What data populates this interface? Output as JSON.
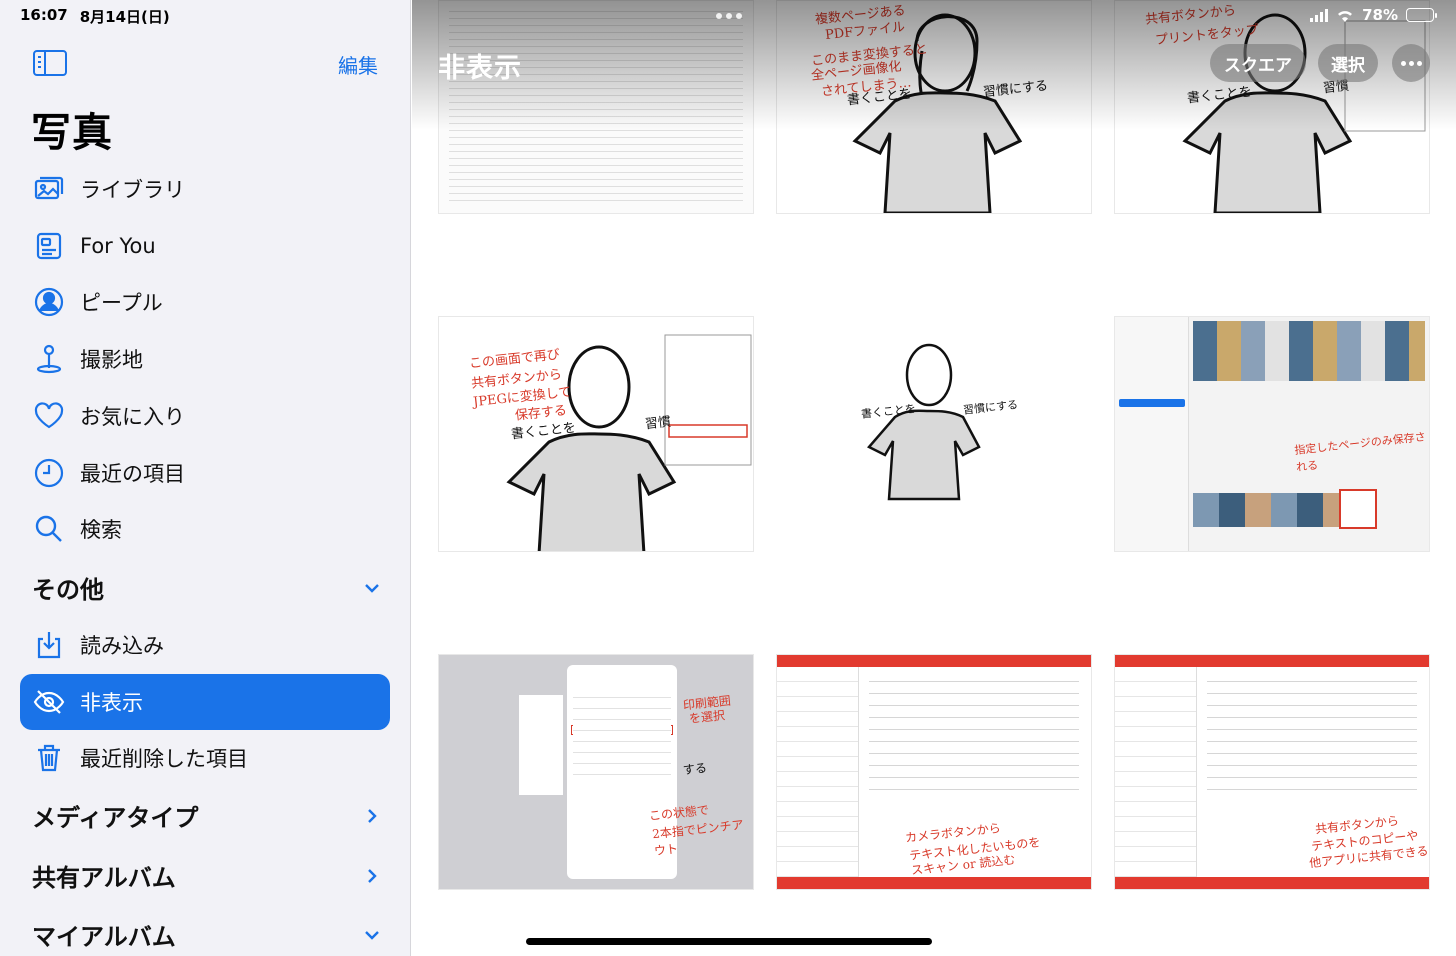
{
  "status": {
    "time": "16:07",
    "date": "8月14日(日)",
    "battery": "78%",
    "battery_level": 0.78
  },
  "sidebar": {
    "edit_label": "編集",
    "title": "写真",
    "items": [
      {
        "label": "ライブラリ",
        "icon": "photo-library-icon"
      },
      {
        "label": "For You",
        "icon": "for-you-icon"
      },
      {
        "label": "ピープル",
        "icon": "person-icon"
      },
      {
        "label": "撮影地",
        "icon": "map-pin-icon"
      },
      {
        "label": "お気に入り",
        "icon": "heart-icon"
      },
      {
        "label": "最近の項目",
        "icon": "clock-icon"
      },
      {
        "label": "検索",
        "icon": "search-icon"
      }
    ],
    "other_section": {
      "label": "その他",
      "items": [
        {
          "label": "読み込み",
          "icon": "import-icon"
        },
        {
          "label": "非表示",
          "icon": "eye-slash-icon",
          "selected": true
        },
        {
          "label": "最近削除した項目",
          "icon": "trash-icon"
        }
      ]
    },
    "media_types_label": "メディアタイプ",
    "shared_albums_label": "共有アルバム",
    "my_albums_label": "マイアルバム"
  },
  "main": {
    "title": "非表示",
    "square_label": "スクエア",
    "select_label": "選択",
    "tiles": [
      {
        "kind": "document",
        "notes": []
      },
      {
        "kind": "sketch",
        "notes": [
          "複数ページある",
          "PDFファイル",
          "このまま変換すると",
          "全ページ画像化",
          "されてしまう…",
          "書くことを",
          "習慣にする"
        ]
      },
      {
        "kind": "sketch-menu",
        "notes": [
          "共有ボタンから",
          "プリントをタップ",
          "書くことを",
          "習慣"
        ]
      },
      {
        "kind": "sketch-menu",
        "notes": [
          "この画面で再び",
          "共有ボタンから",
          "JPEGに変換して",
          "保存する",
          "書くことを",
          "習慣"
        ]
      },
      {
        "kind": "sketch",
        "notes": [
          "書くことを",
          "習慣にする"
        ]
      },
      {
        "kind": "photos",
        "notes": [
          "指定したページのみ保存される"
        ]
      },
      {
        "kind": "print",
        "notes": [
          "印刷範囲",
          "を選択",
          "この状態で",
          "2本指でピンチアウト",
          "する"
        ]
      },
      {
        "kind": "memo",
        "notes": [
          "カメラボタンから",
          "テキスト化したいものを",
          "スキャン or 読込む"
        ]
      },
      {
        "kind": "memo",
        "notes": [
          "共有ボタンから",
          "テキストのコピーや",
          "他アプリに共有できる"
        ]
      }
    ]
  },
  "colors": {
    "accent": "#1a73e8",
    "memo_red": "#e23a2f",
    "note_red": "#d83a2a",
    "sidebar_bg": "#f2f2f7"
  }
}
